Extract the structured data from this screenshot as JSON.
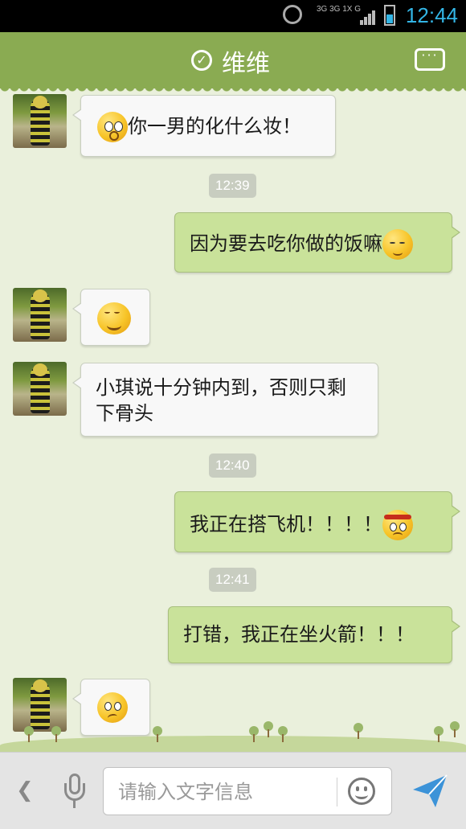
{
  "status_bar": {
    "network": "3G 3G 1X G",
    "clock": "12:44"
  },
  "header": {
    "title": "维维",
    "check_icon": "check-circle-icon",
    "more_icon": "more-options-icon"
  },
  "messages": [
    {
      "side": "left",
      "text": "你一男的化什么妆！",
      "emoji": "shocked-emoji"
    },
    {
      "type": "time",
      "text": "12:39"
    },
    {
      "side": "right",
      "text": "因为要去吃你做的饭嘛",
      "emoji": "shy-emoji"
    },
    {
      "side": "left",
      "text": "",
      "emoji": "grin-emoji"
    },
    {
      "side": "left",
      "text": "小琪说十分钟内到，否则只剩下骨头"
    },
    {
      "type": "time",
      "text": "12:40"
    },
    {
      "side": "right",
      "text": "我正在搭飞机！！！！",
      "emoji": "determined-emoji"
    },
    {
      "type": "time",
      "text": "12:41"
    },
    {
      "side": "right",
      "text": "打错，我正在坐火箭！！！"
    },
    {
      "side": "left",
      "text": "",
      "emoji": "confused-emoji"
    }
  ],
  "input": {
    "placeholder": "请输入文字信息"
  },
  "colors": {
    "header": "#8aab52",
    "my_bubble": "#c9e29a",
    "their_bubble": "#f8f8f8",
    "background": "#eaf0dc"
  }
}
